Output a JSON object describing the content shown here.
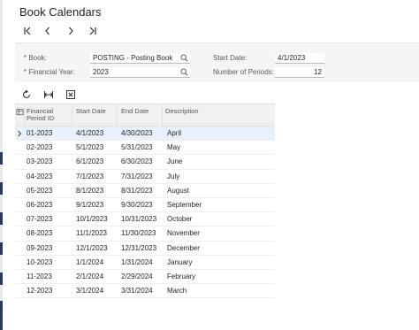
{
  "page": {
    "title": "Book Calendars"
  },
  "nav": {
    "first": "first-record",
    "previous": "previous-record",
    "next": "next-record",
    "last": "last-record"
  },
  "form": {
    "book_label": "Book:",
    "book_value": "POSTING - Posting Book",
    "financial_year_label": "Financial Year:",
    "financial_year_value": "2023",
    "start_date_label": "Start Date:",
    "start_date_value": "4/1/2023",
    "number_of_periods_label": "Number of Periods:",
    "number_of_periods_value": "12"
  },
  "toolbar": {
    "icons": [
      "refresh-icon",
      "fit-columns-icon",
      "export-excel-icon"
    ]
  },
  "grid": {
    "columns": [
      "Financial Period ID",
      "Start Date",
      "End Date",
      "Description"
    ],
    "column_line1": [
      "Financial",
      "Start Date",
      "End Date",
      "Description"
    ],
    "column_line2": [
      "Period ID",
      "",
      "",
      ""
    ],
    "rows": [
      {
        "period": "01-2023",
        "start": "4/1/2023",
        "end": "4/30/2023",
        "desc": "April"
      },
      {
        "period": "02-2023",
        "start": "5/1/2023",
        "end": "5/31/2023",
        "desc": "May"
      },
      {
        "period": "03-2023",
        "start": "6/1/2023",
        "end": "6/30/2023",
        "desc": "June"
      },
      {
        "period": "04-2023",
        "start": "7/1/2023",
        "end": "7/31/2023",
        "desc": "July"
      },
      {
        "period": "05-2023",
        "start": "8/1/2023",
        "end": "8/31/2023",
        "desc": "August"
      },
      {
        "period": "06-2023",
        "start": "9/1/2023",
        "end": "9/30/2023",
        "desc": "September"
      },
      {
        "period": "07-2023",
        "start": "10/1/2023",
        "end": "10/31/2023",
        "desc": "October"
      },
      {
        "period": "08-2023",
        "start": "11/1/2023",
        "end": "11/30/2023",
        "desc": "November"
      },
      {
        "period": "09-2023",
        "start": "12/1/2023",
        "end": "12/31/2023",
        "desc": "December"
      },
      {
        "period": "10-2023",
        "start": "1/1/2024",
        "end": "1/31/2024",
        "desc": "January"
      },
      {
        "period": "11-2023",
        "start": "2/1/2024",
        "end": "2/29/2024",
        "desc": "February"
      },
      {
        "period": "12-2023",
        "start": "3/1/2024",
        "end": "3/31/2024",
        "desc": "March"
      }
    ]
  },
  "colors": {
    "active_row": "#e8f1fb",
    "panel_bg": "#f4f5f7",
    "accent": "#2a3a5a"
  }
}
